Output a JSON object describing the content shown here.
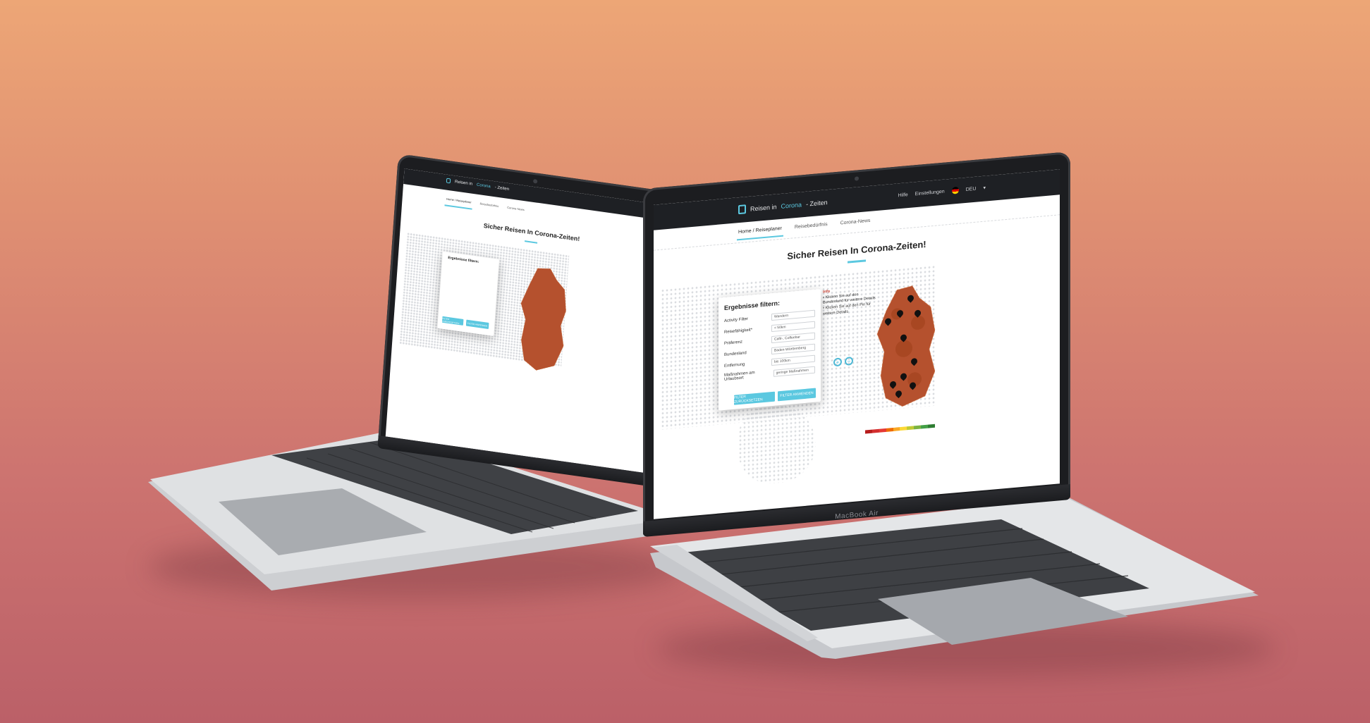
{
  "laptop": {
    "brand_label": "MacBook Air"
  },
  "website": {
    "logo": {
      "part1": "Reisen in ",
      "accent": "Corona",
      "part2": " - Zeiten"
    },
    "header": {
      "help": "Hilfe",
      "account": "Einstellungen",
      "language": "DEU"
    },
    "tabs": [
      "Home / Reiseplaner",
      "Reisebedürfnis",
      "Corona-News"
    ],
    "page_title": "Sicher Reisen In Corona-Zeiten!",
    "filter": {
      "title": "Ergebnisse filtern:",
      "rows": [
        {
          "label": "Activity Filter",
          "value": "Wandern"
        },
        {
          "label": "Reisefähigkeit*",
          "value": "< 50km"
        },
        {
          "label": "Präferenz",
          "value": "Café-, Coffeebar"
        },
        {
          "label": "Bundesland",
          "value": "Baden-Württemberg"
        },
        {
          "label": "Entfernung",
          "value": "bis 100km"
        },
        {
          "label": "Maßnahmen am Urlaubsort",
          "value": "geringe Maßnahmen"
        }
      ],
      "reset_button": "FILTER ZURÜCKSETZEN",
      "apply_button": "FILTER ANWENDEN"
    },
    "info": {
      "title": "Info",
      "lines": [
        "• Klicken Sie auf den Bundesland für weitere Details",
        "• Klicken Sie auf den Pin für weitere Details"
      ]
    },
    "legend_colors": [
      "#b71c1c",
      "#d32f2f",
      "#e53935",
      "#ef6c00",
      "#f9a825",
      "#fdd835",
      "#c0ca33",
      "#7cb342",
      "#43a047",
      "#2e7d32"
    ]
  }
}
